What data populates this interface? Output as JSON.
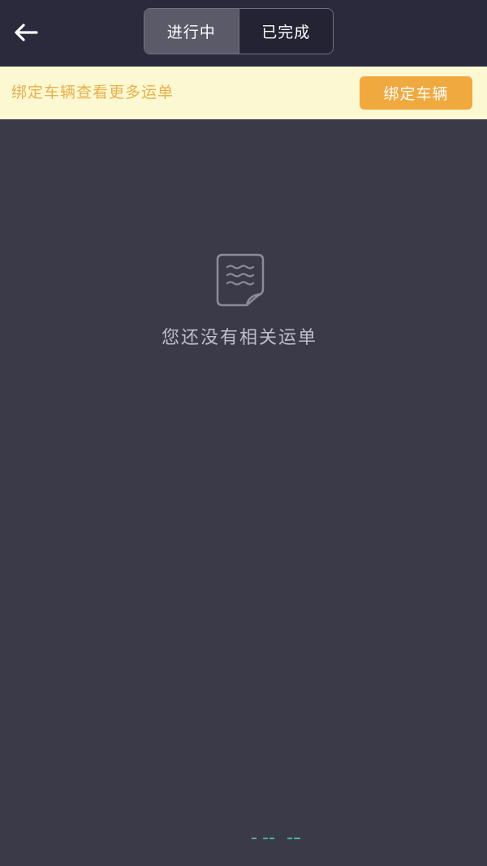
{
  "header": {
    "tabs": [
      {
        "label": "进行中",
        "active": true
      },
      {
        "label": "已完成",
        "active": false
      }
    ]
  },
  "banner": {
    "text": "绑定车辆查看更多运单",
    "button_label": "绑定车辆"
  },
  "empty_state": {
    "message": "您还没有相关运单",
    "icon": "document-icon"
  },
  "colors": {
    "background": "#3b3a49",
    "header": "#2a2a3c",
    "banner_bg": "#fcf8d2",
    "banner_text": "#e9b04a",
    "accent_button": "#f0a93f"
  }
}
